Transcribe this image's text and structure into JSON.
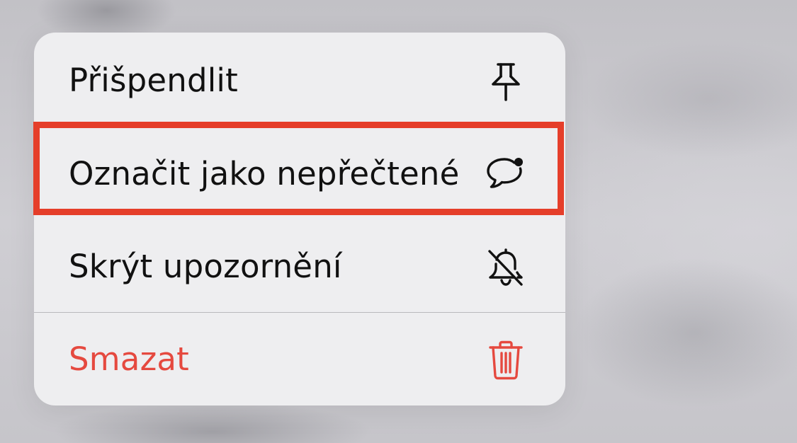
{
  "menu": {
    "items": [
      {
        "label": "Přišpendlit",
        "icon": "pin-icon"
      },
      {
        "label": "Označit jako nepřečtené",
        "icon": "unread-bubble-icon"
      },
      {
        "label": "Skrýt upozornění",
        "icon": "bell-slash-icon"
      },
      {
        "label": "Smazat",
        "icon": "trash-icon",
        "destructive": true
      }
    ]
  },
  "highlight": {
    "target": "Označit jako nepřečtené",
    "color": "#e53e2a"
  },
  "colors": {
    "menu_background": "#eeeef0",
    "text": "#111111",
    "destructive": "#e5493f",
    "separator": "#b9b9bd"
  }
}
